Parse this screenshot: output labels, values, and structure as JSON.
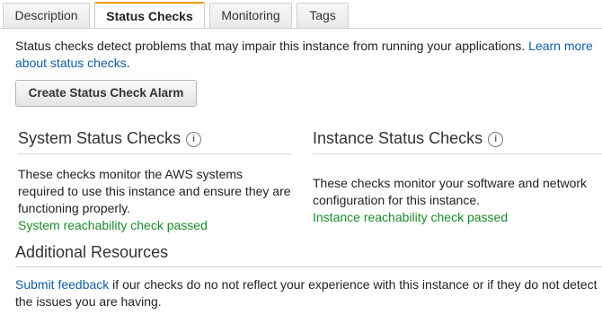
{
  "tabs": [
    {
      "label": "Description",
      "active": false
    },
    {
      "label": "Status Checks",
      "active": true
    },
    {
      "label": "Monitoring",
      "active": false
    },
    {
      "label": "Tags",
      "active": false
    }
  ],
  "intro": {
    "text": "Status checks detect problems that may impair this instance from running your applications. ",
    "link_line1": "Learn more",
    "link_line2": "about status checks",
    "after": "."
  },
  "create_alarm_button": "Create Status Check Alarm",
  "system_checks": {
    "title": "System Status Checks",
    "info_icon": "i",
    "line1": "These checks monitor the AWS systems",
    "line2": "required to use this instance and ensure they are",
    "line3": "functioning properly.",
    "status": "System reachability check passed"
  },
  "instance_checks": {
    "title": "Instance Status Checks",
    "info_icon": "i",
    "line1": "These checks monitor your software and network",
    "line2": "configuration for this instance.",
    "status": "Instance reachability check passed"
  },
  "additional": {
    "title": "Additional Resources",
    "link": "Submit feedback",
    "text_line1": " if our checks do no not reflect your experience with this instance or if they do not detect",
    "text_line2": "the issues you are having."
  },
  "colors": {
    "accent_tab": "#f39c12",
    "link": "#0f5ea3",
    "pass": "#1a8a2a"
  }
}
